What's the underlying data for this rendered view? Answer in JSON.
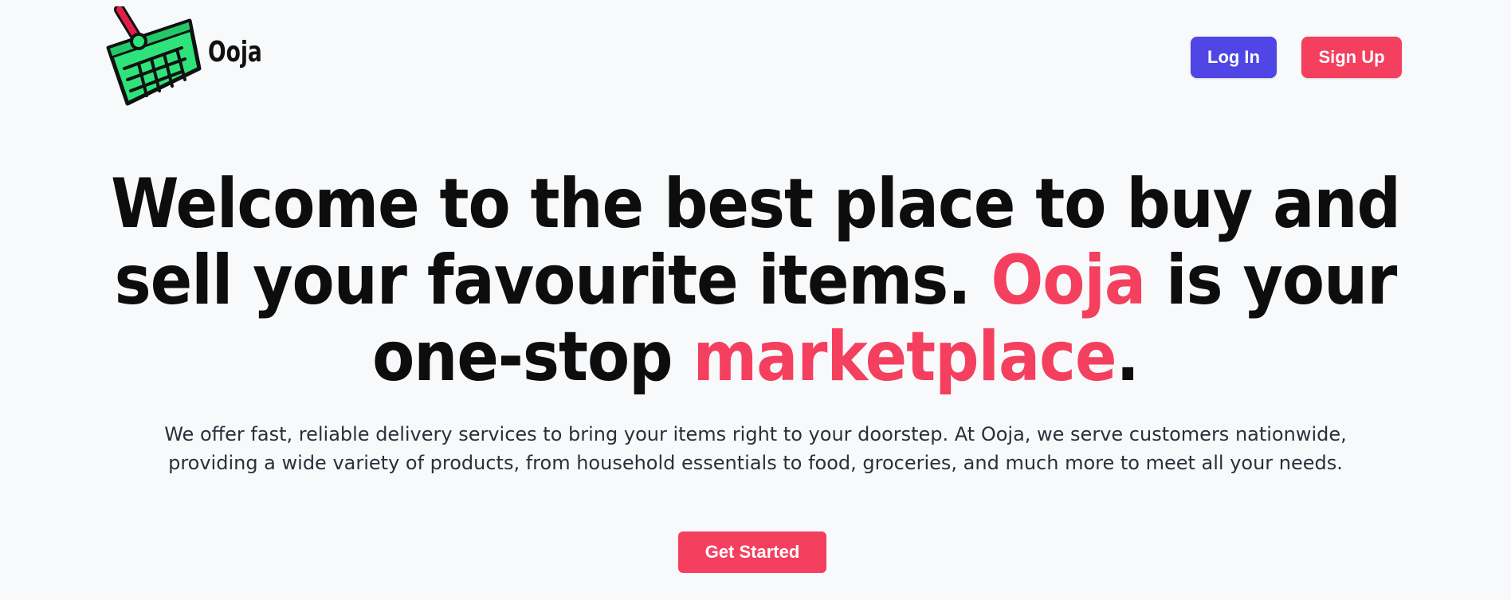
{
  "brand": {
    "name": "Ooja",
    "logo_icon": "shopping-basket-icon",
    "colors": {
      "basket_green": "#2ee47a",
      "handle_red": "#e11d48",
      "outline": "#111111"
    }
  },
  "nav": {
    "login_label": "Log In",
    "signup_label": "Sign Up"
  },
  "hero": {
    "title_part1": "Welcome to the best place to buy and sell your favourite items. ",
    "title_brand": "Ooja",
    "title_part2": " is your one-stop ",
    "title_accent": "marketplace",
    "title_end": ".",
    "subtitle": "We offer fast, reliable delivery services to bring your items right to your doorstep. At Ooja, we serve customers nationwide, providing a wide variety of products, from household essentials to food, groceries, and much more to meet all your needs.",
    "cta_label": "Get Started"
  },
  "theme": {
    "background": "#f8f9fb",
    "primary_indigo": "#4f46e5",
    "accent_pink": "#f43f5e",
    "heading_color": "#0d0d0d",
    "body_text": "#2b2f3a"
  }
}
